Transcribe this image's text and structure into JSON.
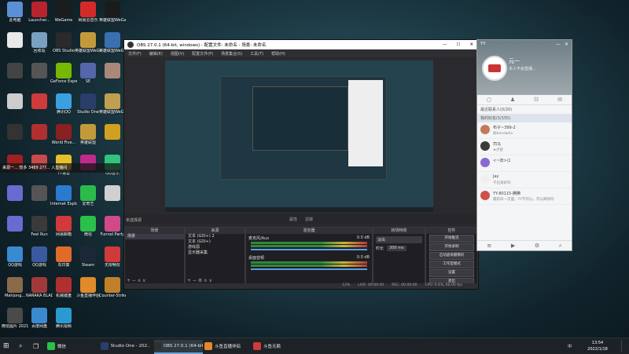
{
  "desktop": {
    "icons": [
      {
        "label": "此电脑",
        "color": "#5b8fd6"
      },
      {
        "label": "Launcher...",
        "color": "#b9232e"
      },
      {
        "label": "WeGame",
        "color": "#1c1c1c"
      },
      {
        "label": "网易云音乐",
        "color": "#d62a2a"
      },
      {
        "label": "英雄联盟WeGame版",
        "color": "#1b1b1b"
      },
      {
        "label": "",
        "color": "#e8e8e8"
      },
      {
        "label": "回收站",
        "color": "#7aa0c0"
      },
      {
        "label": "OBS Studio",
        "color": "#2a2a2a"
      },
      {
        "label": "英雄联盟WeGame版",
        "color": "#c29a3a"
      },
      {
        "label": "英雄联盟WeGame版",
        "color": "#3a6fb0"
      },
      {
        "label": "",
        "color": "#444"
      },
      {
        "label": "",
        "color": "#555"
      },
      {
        "label": "GeForce Experience",
        "color": "#76b900"
      },
      {
        "label": "SE",
        "color": "#5566aa"
      },
      {
        "label": "",
        "color": "#aa8877"
      },
      {
        "label": "",
        "color": "#cccccc"
      },
      {
        "label": "",
        "color": "#d03a3a"
      },
      {
        "label": "腾讯QQ",
        "color": "#3aa0e0"
      },
      {
        "label": "Studio One",
        "color": "#2a3e6a"
      },
      {
        "label": "英雄联盟WeGame版",
        "color": "#c0a050"
      },
      {
        "label": "",
        "color": "#333"
      },
      {
        "label": "",
        "color": "#b03030"
      },
      {
        "label": "World Five...",
        "color": "#8a2020"
      },
      {
        "label": "英雄联盟",
        "color": "#c29a3a"
      },
      {
        "label": "",
        "color": "#d0a020"
      },
      {
        "label": "",
        "color": "#a02020"
      },
      {
        "label": "",
        "color": "#c84a4a"
      },
      {
        "label": "YY语音",
        "color": "#e6c02a"
      },
      {
        "label": "",
        "color": "#c02a8a"
      },
      {
        "label": "QQ音乐",
        "color": "#31c27c"
      },
      {
        "label": "",
        "color": "#6a6ad0"
      },
      {
        "label": "",
        "color": "#555"
      },
      {
        "label": "Internet Explorer",
        "color": "#2a7ad0"
      },
      {
        "label": "爱奇艺",
        "color": "#2abb4a"
      },
      {
        "label": "",
        "color": "#d0d0d0"
      },
      {
        "label": "",
        "color": "#6a6ad0"
      },
      {
        "label": "Feel Run",
        "color": "#3a3a3a"
      },
      {
        "label": "网易邮箱",
        "color": "#d03a3a"
      },
      {
        "label": "微信",
        "color": "#2ac04a"
      },
      {
        "label": "Funnel Party",
        "color": "#d04a8a"
      },
      {
        "label": "QQ游戏",
        "color": "#3a8ad0"
      },
      {
        "label": "QQ游戏",
        "color": "#3a5aa0"
      },
      {
        "label": "向日葵",
        "color": "#e06a2a"
      },
      {
        "label": "Steam",
        "color": "#1b2838"
      },
      {
        "label": "无限畅玩",
        "color": "#d03a3a"
      },
      {
        "label": "Mahjong...",
        "color": "#8a6a4a"
      },
      {
        "label": "NARAKA BLADEPO...",
        "color": "#a03a3a"
      },
      {
        "label": "机械键盘",
        "color": "#b03030"
      },
      {
        "label": "斗鱼直播伴侣",
        "color": "#e08a2a"
      },
      {
        "label": "Counter-Strike Global Of...",
        "color": "#c0802a"
      },
      {
        "label": "微信图片 2021120...",
        "color": "#4a4a4a"
      },
      {
        "label": "百度网盘",
        "color": "#3a8ad0"
      },
      {
        "label": "腾讯视频",
        "color": "#2a9ad0"
      }
    ]
  },
  "notification": {
    "text": "来源一... 较多 3489 2??... 入直播间"
  },
  "obs": {
    "title": "OBS 27.0.1 (64-bit, windows) - 配置文件: 未命名 - 场景: 未命名",
    "menu": [
      "文件(F)",
      "编辑(E)",
      "视图(V)",
      "配置文件(P)",
      "场景集合(S)",
      "工具(T)",
      "帮助(H)"
    ],
    "preview_labels": {
      "properties": "属性",
      "filters": "滤镜"
    },
    "unsel_label": "未选择源",
    "scenes": {
      "header": "场景",
      "items": [
        "场景"
      ]
    },
    "sources": {
      "header": "来源",
      "items": [
        "文本 (GDI+) 2",
        "文本 (GDI+)",
        "游戏源",
        "显示器采集"
      ]
    },
    "mixer": {
      "header": "混音器",
      "channels": [
        {
          "name": "麦克风/Aux",
          "level": "0.0 dB"
        },
        {
          "name": "桌面音频",
          "level": "0.0 dB"
        }
      ]
    },
    "transitions": {
      "header": "转场特效",
      "type": "淡出",
      "duration_label": "时长",
      "duration": "300 ms"
    },
    "controls": {
      "header": "控件",
      "buttons": [
        "开始推流",
        "开始录制",
        "启动虚拟摄像机",
        "工作室模式",
        "设置",
        "退出"
      ]
    },
    "status": {
      "live": "LIVE: 00:00:00",
      "rec": "REC: 00:00:00",
      "cpu": "CPU: 0.4%, 60.00 fps",
      "drop": "12%"
    }
  },
  "yy": {
    "title": "YY",
    "name": "元一",
    "sig": "本人不会直播...",
    "groups": [
      "最近联系人(0/20)",
      "我的好友(5/155)"
    ],
    "friends": [
      {
        "name": "布子~399-2",
        "sig": "知bandwhe",
        "color": "#c27a5a"
      },
      {
        "name": "司马",
        "sig": "★点星",
        "color": "#3a3a3a"
      },
      {
        "name": "<~旧>ロ",
        "sig": "",
        "color": "#8a6ad0"
      },
      {
        "name": "Jay",
        "sig": "千出某好吗",
        "color": "#f0f0f0"
      },
      {
        "name": "YY-80115-腾腾",
        "sig": "最新日一次面，YY不可以，可以麻烦吗",
        "color": "#d0504a"
      }
    ]
  },
  "taskbar": {
    "items": [
      {
        "label": "微信",
        "color": "#2ac04a"
      },
      {
        "label": "Studio One - 202...",
        "color": "#2a3e6a"
      },
      {
        "label": "OBS 27.0.1 (64-bit...",
        "color": "#303030"
      },
      {
        "label": "斗鱼直播伴侣",
        "color": "#e08a2a"
      },
      {
        "label": "斗鱼无赖",
        "color": "#d03a3a"
      }
    ],
    "time": "13:54",
    "date": "2022/1/18",
    "lang": "中"
  }
}
